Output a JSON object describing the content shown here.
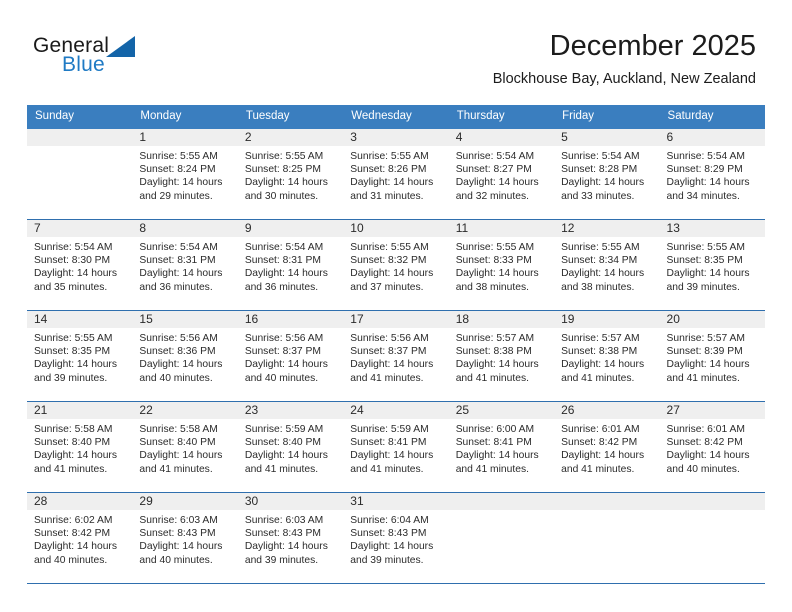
{
  "brand": {
    "name_part1": "General",
    "name_part2": "Blue",
    "triangle_icon": "triangle-logo-icon",
    "color_primary": "#1364a8",
    "color_secondary": "#1f7ac4"
  },
  "header": {
    "title": "December 2025",
    "location": "Blockhouse Bay, Auckland, New Zealand"
  },
  "theme": {
    "header_row_bg": "#3a7ebf",
    "daynum_bg": "#efefef",
    "row_separator": "#2f6fae",
    "text": "#2b2b2b"
  },
  "weekdays": [
    "Sunday",
    "Monday",
    "Tuesday",
    "Wednesday",
    "Thursday",
    "Friday",
    "Saturday"
  ],
  "labels": {
    "sunrise_prefix": "Sunrise:",
    "sunset_prefix": "Sunset:",
    "daylight_prefix": "Daylight:"
  },
  "weeks": [
    [
      {
        "day": "",
        "sunrise": "",
        "sunset": "",
        "daylight": "",
        "empty": true
      },
      {
        "day": "1",
        "sunrise": "Sunrise: 5:55 AM",
        "sunset": "Sunset: 8:24 PM",
        "daylight": "Daylight: 14 hours and 29 minutes."
      },
      {
        "day": "2",
        "sunrise": "Sunrise: 5:55 AM",
        "sunset": "Sunset: 8:25 PM",
        "daylight": "Daylight: 14 hours and 30 minutes."
      },
      {
        "day": "3",
        "sunrise": "Sunrise: 5:55 AM",
        "sunset": "Sunset: 8:26 PM",
        "daylight": "Daylight: 14 hours and 31 minutes."
      },
      {
        "day": "4",
        "sunrise": "Sunrise: 5:54 AM",
        "sunset": "Sunset: 8:27 PM",
        "daylight": "Daylight: 14 hours and 32 minutes."
      },
      {
        "day": "5",
        "sunrise": "Sunrise: 5:54 AM",
        "sunset": "Sunset: 8:28 PM",
        "daylight": "Daylight: 14 hours and 33 minutes."
      },
      {
        "day": "6",
        "sunrise": "Sunrise: 5:54 AM",
        "sunset": "Sunset: 8:29 PM",
        "daylight": "Daylight: 14 hours and 34 minutes."
      }
    ],
    [
      {
        "day": "7",
        "sunrise": "Sunrise: 5:54 AM",
        "sunset": "Sunset: 8:30 PM",
        "daylight": "Daylight: 14 hours and 35 minutes."
      },
      {
        "day": "8",
        "sunrise": "Sunrise: 5:54 AM",
        "sunset": "Sunset: 8:31 PM",
        "daylight": "Daylight: 14 hours and 36 minutes."
      },
      {
        "day": "9",
        "sunrise": "Sunrise: 5:54 AM",
        "sunset": "Sunset: 8:31 PM",
        "daylight": "Daylight: 14 hours and 36 minutes."
      },
      {
        "day": "10",
        "sunrise": "Sunrise: 5:55 AM",
        "sunset": "Sunset: 8:32 PM",
        "daylight": "Daylight: 14 hours and 37 minutes."
      },
      {
        "day": "11",
        "sunrise": "Sunrise: 5:55 AM",
        "sunset": "Sunset: 8:33 PM",
        "daylight": "Daylight: 14 hours and 38 minutes."
      },
      {
        "day": "12",
        "sunrise": "Sunrise: 5:55 AM",
        "sunset": "Sunset: 8:34 PM",
        "daylight": "Daylight: 14 hours and 38 minutes."
      },
      {
        "day": "13",
        "sunrise": "Sunrise: 5:55 AM",
        "sunset": "Sunset: 8:35 PM",
        "daylight": "Daylight: 14 hours and 39 minutes."
      }
    ],
    [
      {
        "day": "14",
        "sunrise": "Sunrise: 5:55 AM",
        "sunset": "Sunset: 8:35 PM",
        "daylight": "Daylight: 14 hours and 39 minutes."
      },
      {
        "day": "15",
        "sunrise": "Sunrise: 5:56 AM",
        "sunset": "Sunset: 8:36 PM",
        "daylight": "Daylight: 14 hours and 40 minutes."
      },
      {
        "day": "16",
        "sunrise": "Sunrise: 5:56 AM",
        "sunset": "Sunset: 8:37 PM",
        "daylight": "Daylight: 14 hours and 40 minutes."
      },
      {
        "day": "17",
        "sunrise": "Sunrise: 5:56 AM",
        "sunset": "Sunset: 8:37 PM",
        "daylight": "Daylight: 14 hours and 41 minutes."
      },
      {
        "day": "18",
        "sunrise": "Sunrise: 5:57 AM",
        "sunset": "Sunset: 8:38 PM",
        "daylight": "Daylight: 14 hours and 41 minutes."
      },
      {
        "day": "19",
        "sunrise": "Sunrise: 5:57 AM",
        "sunset": "Sunset: 8:38 PM",
        "daylight": "Daylight: 14 hours and 41 minutes."
      },
      {
        "day": "20",
        "sunrise": "Sunrise: 5:57 AM",
        "sunset": "Sunset: 8:39 PM",
        "daylight": "Daylight: 14 hours and 41 minutes."
      }
    ],
    [
      {
        "day": "21",
        "sunrise": "Sunrise: 5:58 AM",
        "sunset": "Sunset: 8:40 PM",
        "daylight": "Daylight: 14 hours and 41 minutes."
      },
      {
        "day": "22",
        "sunrise": "Sunrise: 5:58 AM",
        "sunset": "Sunset: 8:40 PM",
        "daylight": "Daylight: 14 hours and 41 minutes."
      },
      {
        "day": "23",
        "sunrise": "Sunrise: 5:59 AM",
        "sunset": "Sunset: 8:40 PM",
        "daylight": "Daylight: 14 hours and 41 minutes."
      },
      {
        "day": "24",
        "sunrise": "Sunrise: 5:59 AM",
        "sunset": "Sunset: 8:41 PM",
        "daylight": "Daylight: 14 hours and 41 minutes."
      },
      {
        "day": "25",
        "sunrise": "Sunrise: 6:00 AM",
        "sunset": "Sunset: 8:41 PM",
        "daylight": "Daylight: 14 hours and 41 minutes."
      },
      {
        "day": "26",
        "sunrise": "Sunrise: 6:01 AM",
        "sunset": "Sunset: 8:42 PM",
        "daylight": "Daylight: 14 hours and 41 minutes."
      },
      {
        "day": "27",
        "sunrise": "Sunrise: 6:01 AM",
        "sunset": "Sunset: 8:42 PM",
        "daylight": "Daylight: 14 hours and 40 minutes."
      }
    ],
    [
      {
        "day": "28",
        "sunrise": "Sunrise: 6:02 AM",
        "sunset": "Sunset: 8:42 PM",
        "daylight": "Daylight: 14 hours and 40 minutes."
      },
      {
        "day": "29",
        "sunrise": "Sunrise: 6:03 AM",
        "sunset": "Sunset: 8:43 PM",
        "daylight": "Daylight: 14 hours and 40 minutes."
      },
      {
        "day": "30",
        "sunrise": "Sunrise: 6:03 AM",
        "sunset": "Sunset: 8:43 PM",
        "daylight": "Daylight: 14 hours and 39 minutes."
      },
      {
        "day": "31",
        "sunrise": "Sunrise: 6:04 AM",
        "sunset": "Sunset: 8:43 PM",
        "daylight": "Daylight: 14 hours and 39 minutes."
      },
      {
        "day": "",
        "sunrise": "",
        "sunset": "",
        "daylight": "",
        "empty": true
      },
      {
        "day": "",
        "sunrise": "",
        "sunset": "",
        "daylight": "",
        "empty": true
      },
      {
        "day": "",
        "sunrise": "",
        "sunset": "",
        "daylight": "",
        "empty": true
      }
    ]
  ]
}
